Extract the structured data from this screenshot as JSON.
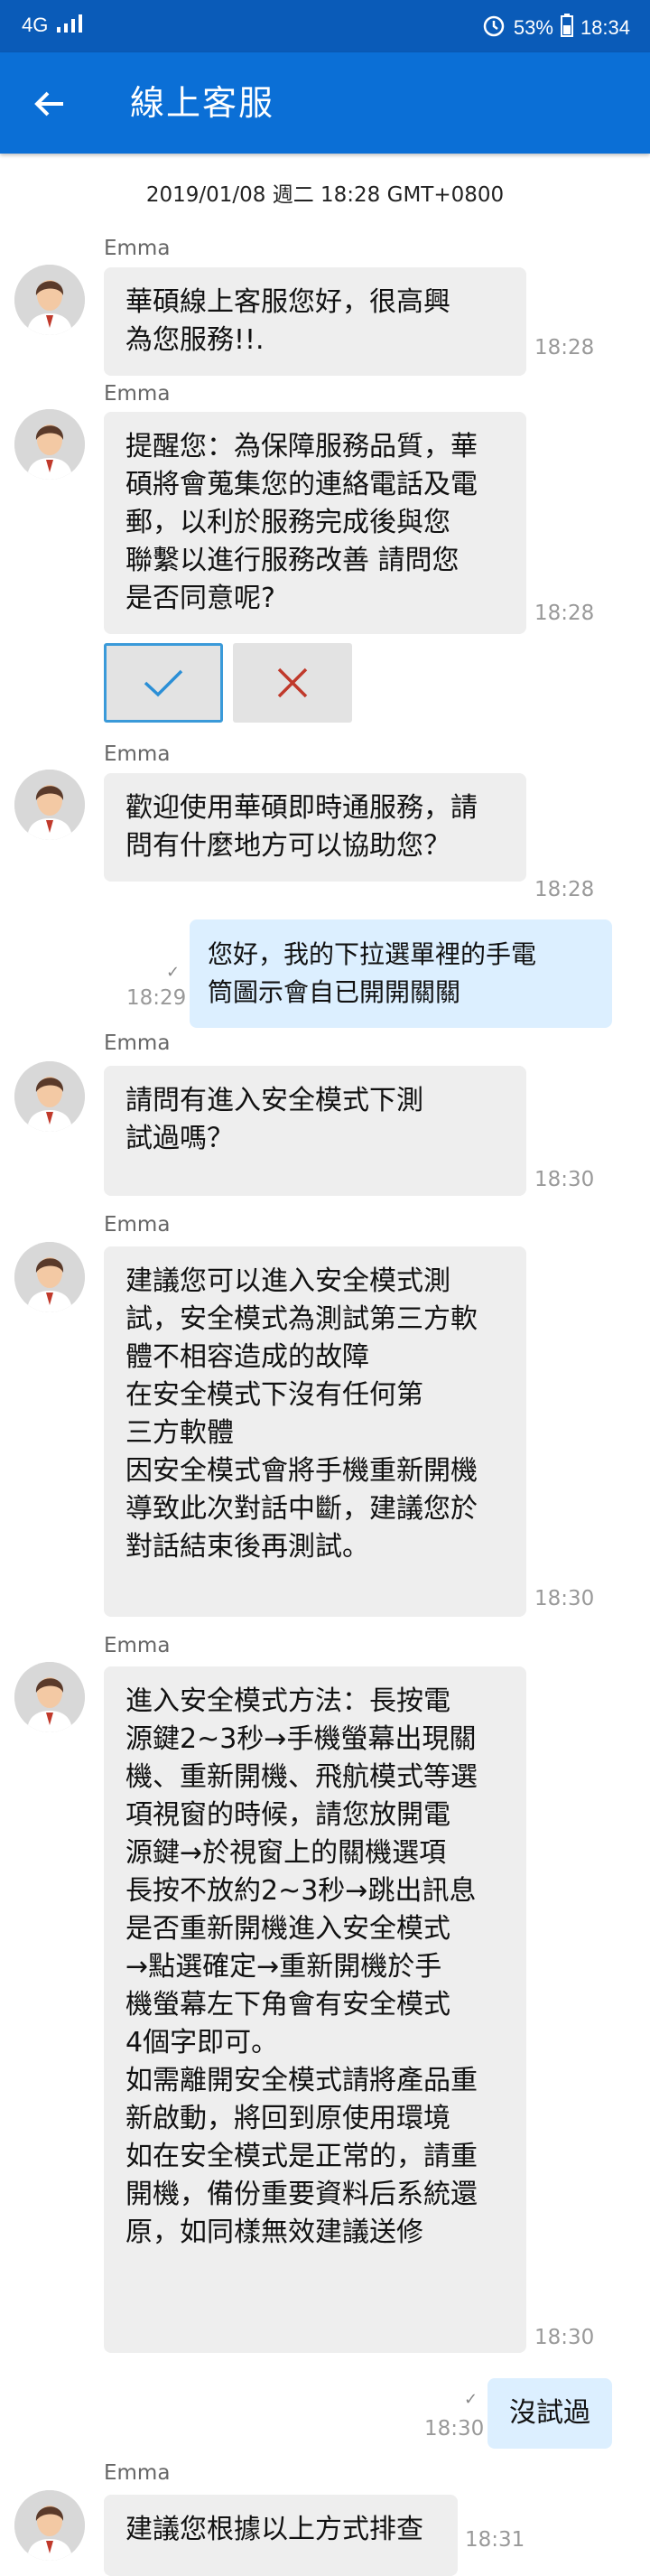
{
  "status": {
    "network": "4G",
    "battery": "53%",
    "clock": "18:34"
  },
  "header": {
    "title": "線上客服"
  },
  "chat": {
    "date": "2019/01/08 週二 18:28 GMT+0800",
    "messages": [
      {
        "sender": "Emma",
        "lines": [
          "華碩線上客服您好，很高興",
          "為您服務!!."
        ],
        "time": "18:28"
      },
      {
        "sender": "Emma",
        "lines": [
          "提醒您：為保障服務品質，華",
          "碩將會蒐集您的連絡電話及電",
          "郵，以利於服務完成後與您",
          "聯繫以進行服務改善 請問您",
          "是否同意呢?"
        ],
        "time": "18:28"
      },
      {
        "sender": "Emma",
        "lines": [
          "歡迎使用華碩即時通服務，請",
          "問有什麼地方可以協助您？"
        ],
        "time": "18:28"
      },
      {
        "lines": [
          "您好，我的下拉選單裡的手電",
          "筒圖示會自已開開關關"
        ],
        "time": "18:29"
      },
      {
        "sender": "Emma",
        "lines": [
          "請問有進入安全模式下測",
          "試過嗎？"
        ],
        "time": "18:30"
      },
      {
        "sender": "Emma",
        "lines": [
          "建議您可以進入安全模式測",
          "試，安全模式為測試第三方軟",
          "體不相容造成的故障",
          "在安全模式下沒有任何第",
          "三方軟體",
          "因安全模式會將手機重新開機",
          "導致此次對話中斷，建議您於",
          "對話結束後再測試。"
        ],
        "time": "18:30"
      },
      {
        "sender": "Emma",
        "lines": [
          "進入安全模式方法：長按電",
          "源鍵2~3秒→手機螢幕出現關",
          "機、重新開機、飛航模式等選",
          "項視窗的時候，請您放開電",
          "源鍵→於視窗上的關機選項",
          "長按不放約2~3秒→跳出訊息",
          "是否重新開機進入安全模式",
          "→點選確定→重新開機於手",
          "機螢幕左下角會有安全模式",
          "4個字即可。",
          "如需離開安全模式請將產品重",
          "新啟動，將回到原使用環境",
          "如在安全模式是正常的，請重",
          "開機，備份重要資料后系統還",
          "原，如同樣無效建議送修"
        ],
        "time": "18:30"
      },
      {
        "lines": [
          "沒試過"
        ],
        "time": "18:30"
      },
      {
        "sender": "Emma",
        "lines": [
          "建議您根據以上方式排查"
        ],
        "time": "18:31"
      }
    ]
  },
  "consent": {
    "accept": "✓",
    "decline": "✕"
  }
}
